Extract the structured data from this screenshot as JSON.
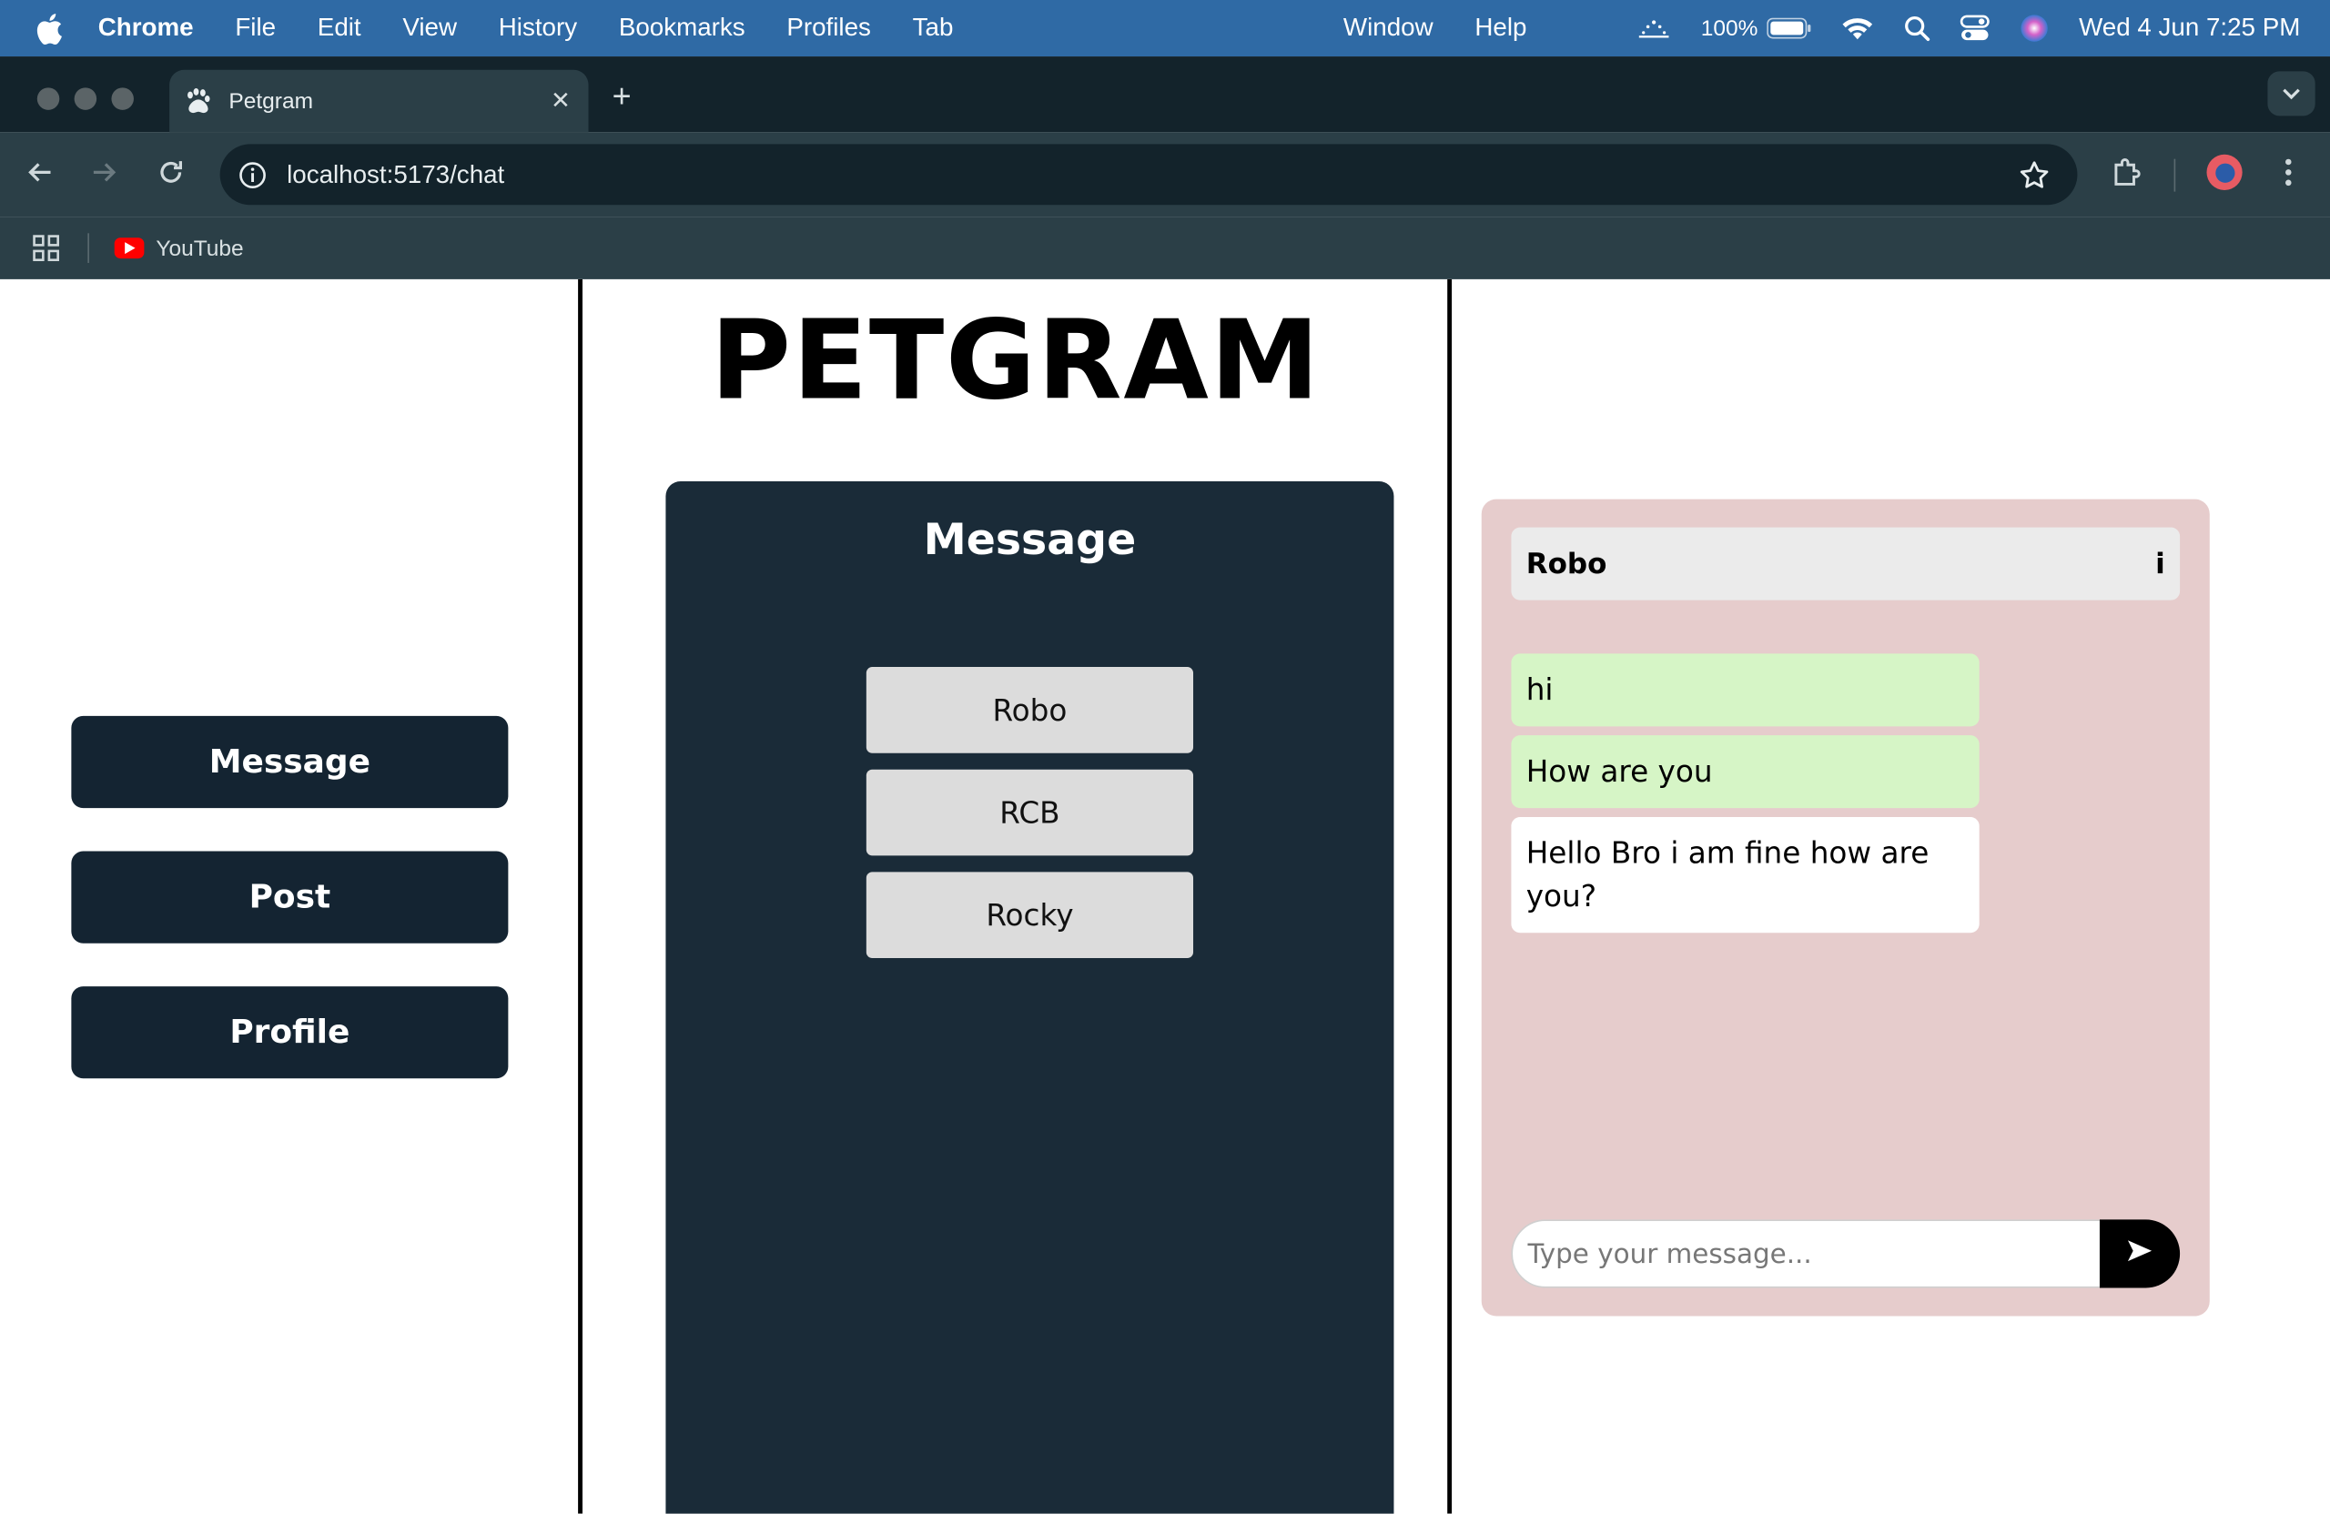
{
  "menubar": {
    "app": "Chrome",
    "items": [
      "File",
      "Edit",
      "View",
      "History",
      "Bookmarks",
      "Profiles",
      "Tab"
    ],
    "right_items": [
      "Window",
      "Help"
    ],
    "battery": "100%",
    "datetime": "Wed 4 Jun  7:25 PM"
  },
  "browser": {
    "tab_title": "Petgram",
    "url": "localhost:5173/chat",
    "bookmark": "YouTube"
  },
  "sidebar": {
    "buttons": [
      "Message",
      "Post",
      "Profile"
    ]
  },
  "brand": "PETGRAM",
  "messages_panel": {
    "title": "Message",
    "contacts": [
      "Robo",
      "RCB",
      "Rocky"
    ]
  },
  "chat": {
    "contact_name": "Robo",
    "info_label": "i",
    "messages": [
      {
        "text": "hi",
        "type": "sent"
      },
      {
        "text": "How are you",
        "type": "sent"
      },
      {
        "text": "Hello Bro i am fine how are you?",
        "type": "received"
      }
    ],
    "input_placeholder": "Type your message...",
    "colors": {
      "sent": "#d6f5c6",
      "received": "#ffffff",
      "panel": "#e6cccc"
    }
  },
  "colors": {
    "menubar": "#2f6aa5",
    "chrome_dark": "#13232b",
    "chrome_toolbar": "#2b3f47",
    "sidebar_button": "#142432",
    "message_panel": "#1a2b38"
  }
}
